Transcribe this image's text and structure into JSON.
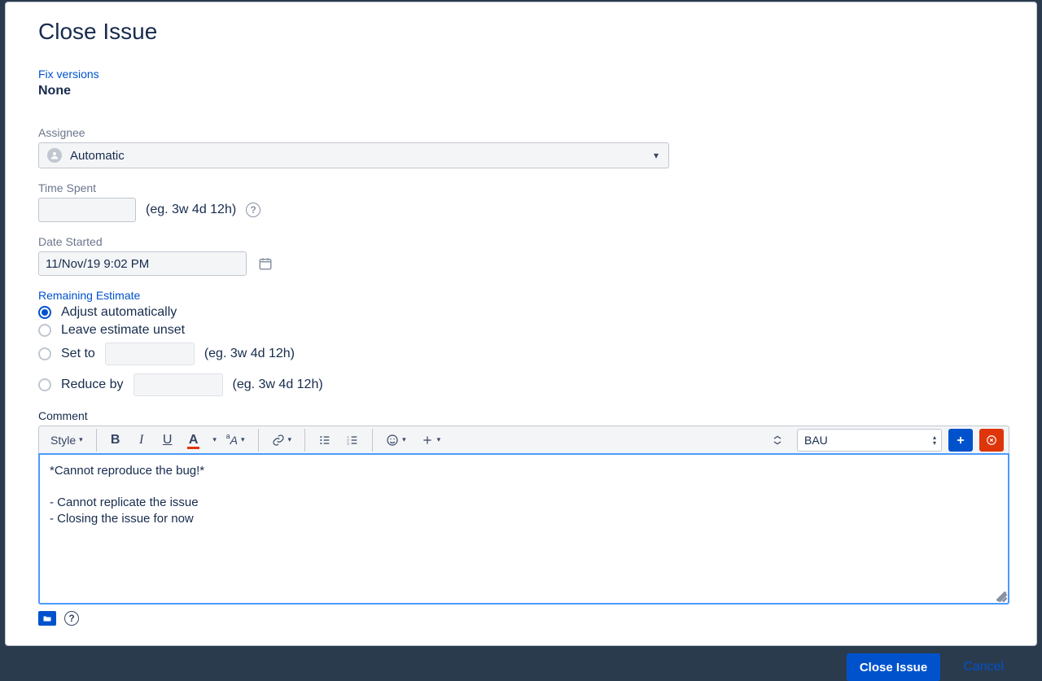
{
  "dialog": {
    "title": "Close Issue"
  },
  "fixVersions": {
    "label": "Fix versions",
    "value": "None"
  },
  "assignee": {
    "label": "Assignee",
    "value": "Automatic"
  },
  "timeSpent": {
    "label": "Time Spent",
    "value": "",
    "hint": "(eg. 3w 4d 12h)"
  },
  "dateStarted": {
    "label": "Date Started",
    "value": "11/Nov/19 9:02 PM"
  },
  "remainingEstimate": {
    "label": "Remaining Estimate",
    "options": {
      "adjust": "Adjust automatically",
      "leave": "Leave estimate unset",
      "setTo": "Set to",
      "reduceBy": "Reduce by"
    },
    "selected": "adjust",
    "hint": "(eg. 3w 4d 12h)"
  },
  "comment": {
    "label": "Comment",
    "styleLabel": "Style",
    "cannedResponse": "BAU",
    "body": "*Cannot reproduce the bug!*\n\n- Cannot replicate the issue\n- Closing the issue for now"
  },
  "footer": {
    "primary": "Close Issue",
    "cancel": "Cancel"
  }
}
